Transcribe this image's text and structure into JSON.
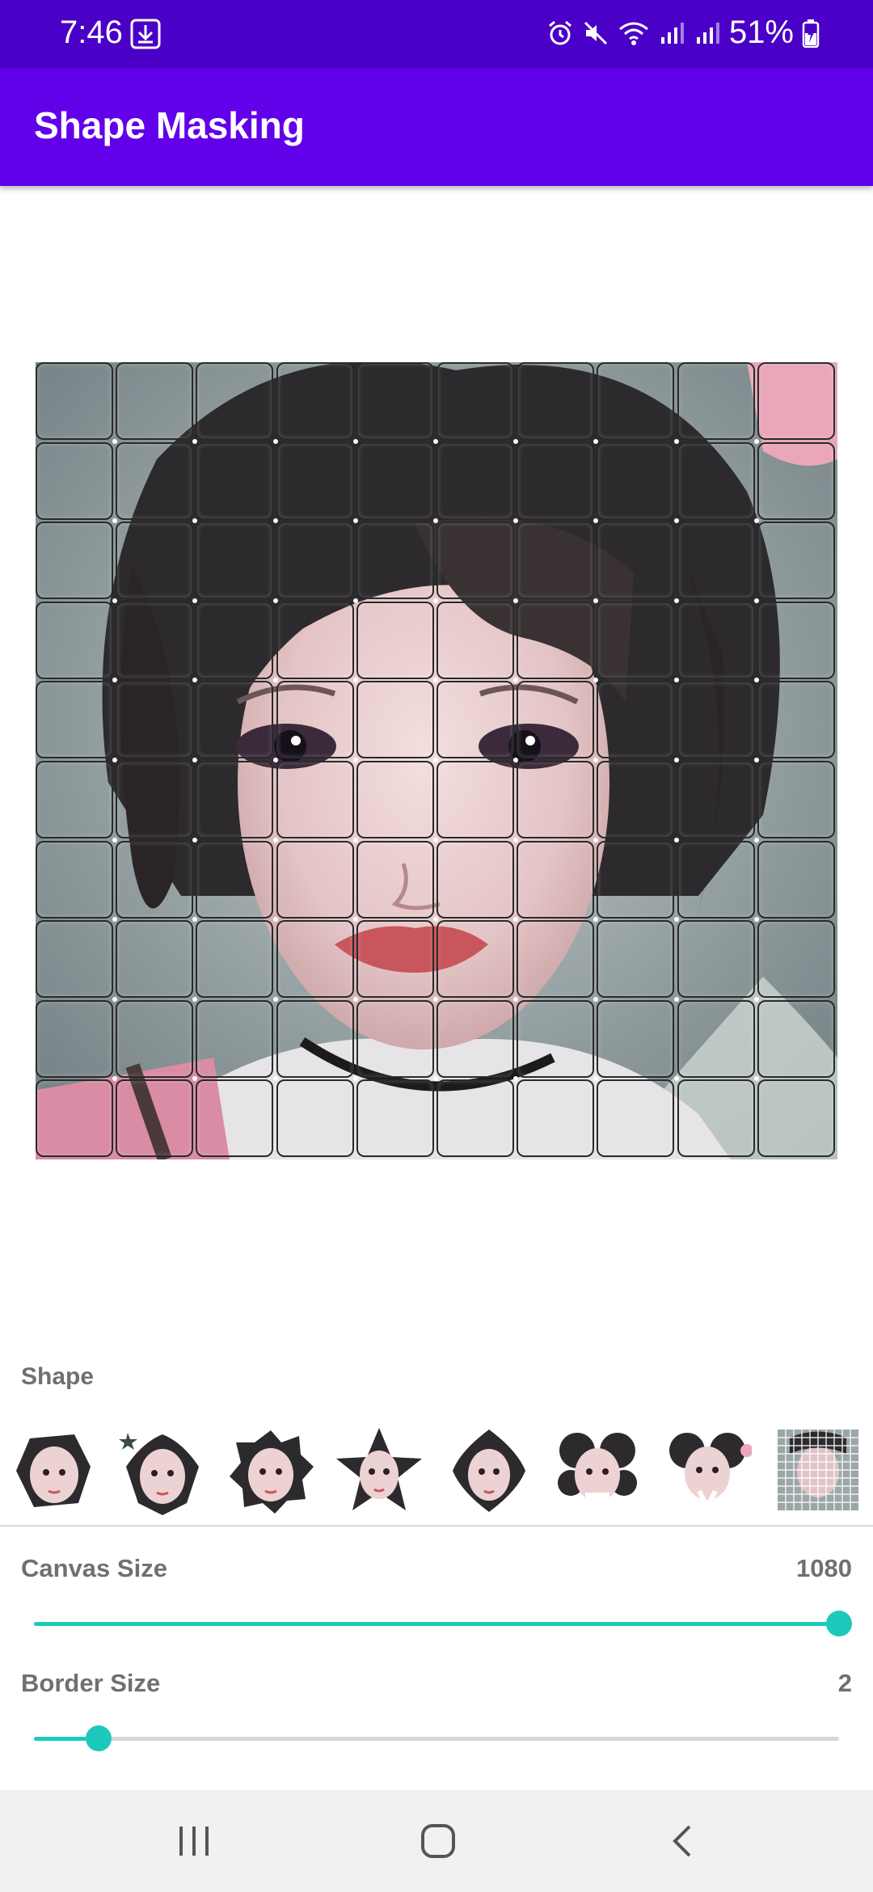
{
  "status_bar": {
    "time": "7:46",
    "battery": "51%"
  },
  "app_bar": {
    "title": "Shape Masking"
  },
  "grid": {
    "rows": 10,
    "cols": 10
  },
  "shape_section": {
    "label": "Shape",
    "items": [
      "face-shape-1",
      "star-shape-small",
      "burst-shape",
      "star-shape",
      "diamond-shape",
      "flower-shape",
      "flower-shape-2",
      "grid-shape"
    ]
  },
  "canvas_size": {
    "label": "Canvas Size",
    "value": "1080",
    "fraction": 1.0
  },
  "border_size": {
    "label": "Border Size",
    "value": "2",
    "fraction": 0.08
  },
  "colors": {
    "status_bar": "#4a00c7",
    "app_bar": "#6200ea",
    "accent": "#1cc9bb"
  }
}
